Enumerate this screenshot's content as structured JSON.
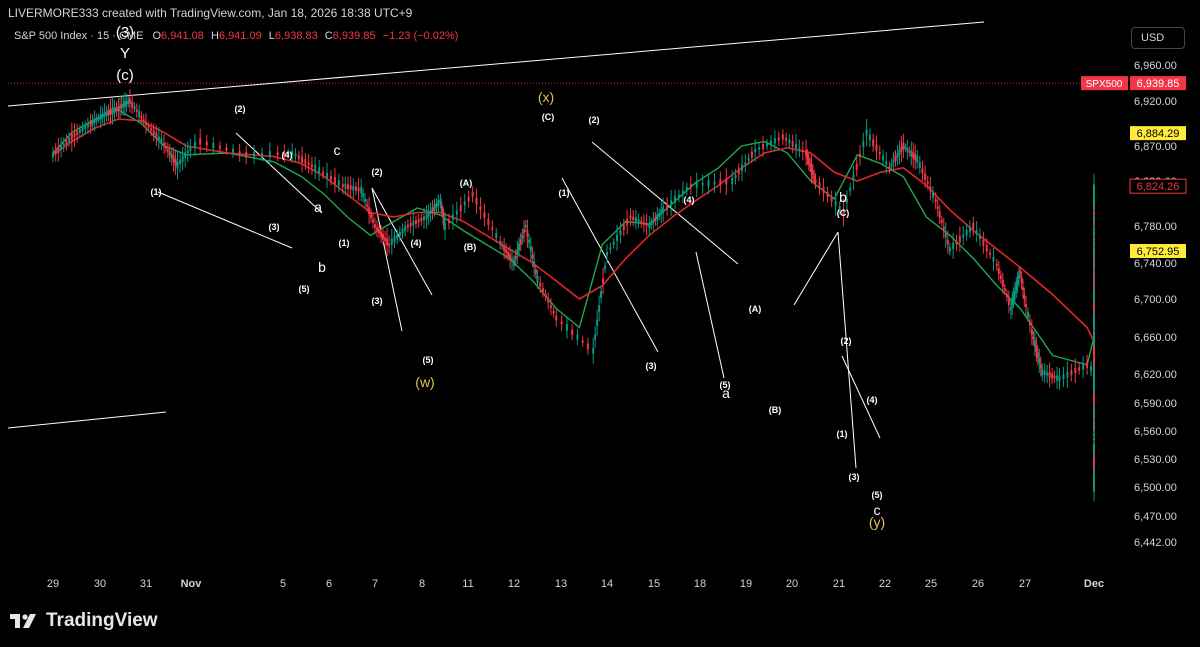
{
  "attribution": "LIVERMORE333 created with TradingView.com, Jan 18, 2026 18:38 UTC+9",
  "legend": {
    "symbol": "S&P 500 Index · 15 · CME",
    "open_label": "O",
    "open": "6,941.08",
    "high_label": "H",
    "high": "6,941.09",
    "low_label": "L",
    "low": "6,938.83",
    "close_label": "C",
    "close": "6,939.85",
    "change": "−1.23 (−0.02%)"
  },
  "currency": "USD",
  "logo_text": "TradingView",
  "colors": {
    "background": "#000000",
    "down": "#f23645",
    "up": "#089981",
    "ma_slow": "#e0262a",
    "ma_fast": "#22c55e",
    "highlight_label": "#ffeb3b",
    "wave_yellow": "#e0c34f",
    "text": "#d1d4dc"
  },
  "chart_data": {
    "type": "line",
    "title": "",
    "y_ticks": [
      "6,960.00",
      "6,920.00",
      "6,870.00",
      "6,830.00",
      "6,780.00",
      "6,740.00",
      "6,700.00",
      "6,660.00",
      "6,620.00",
      "6,590.00",
      "6,560.00",
      "6,530.00",
      "6,500.00",
      "6,470.00",
      "6,442.00"
    ],
    "x_ticks": [
      "29",
      "30",
      "31",
      "Nov",
      "5",
      "6",
      "7",
      "8",
      "11",
      "12",
      "13",
      "14",
      "15",
      "18",
      "19",
      "20",
      "21",
      "22",
      "25",
      "26",
      "27",
      "Dec"
    ],
    "ylim": [
      6442,
      6960
    ],
    "price_tags": [
      {
        "label": "SPX500",
        "value": "6,939.85",
        "style": "red"
      },
      {
        "label": "",
        "value": "6,884.29",
        "style": "yellow"
      },
      {
        "label": "",
        "value": "6,824.26",
        "style": "outline"
      },
      {
        "label": "",
        "value": "6,752.95",
        "style": "yellow"
      }
    ],
    "series": [
      {
        "kind": "price",
        "x": [
          28.6,
          29,
          29.4,
          29.7,
          30,
          30.25,
          30.6,
          31,
          31.3,
          31.7,
          32.2,
          32.8,
          33.3,
          33.9,
          34.3,
          34.6,
          34.9,
          35.3,
          35.7,
          36,
          36.1,
          36.7,
          37.3,
          37.6,
          37.85,
          38.1,
          38.5,
          39.3,
          39.6,
          40.1,
          40.5,
          40.8,
          41.4,
          42.3,
          42.8,
          43.4,
          43.9,
          44.1,
          44.7,
          45.2,
          45.7,
          46,
          46.3,
          46.7,
          47,
          47.5,
          48,
          48.3,
          48.5,
          48.7,
          48.85,
          49.1,
          49.5,
          49.9,
          50.2,
          50.6,
          51,
          51.3,
          51.4,
          51.8,
          52.2,
          52.6,
          52.8,
          53.3,
          53.6,
          53.7,
          54.1,
          54.4,
          54.7,
          55.2,
          55.6,
          56,
          56.6,
          57.2,
          57.8,
          58,
          58.4,
          58.7
        ],
        "y": [
          6860,
          6880,
          6895,
          6905,
          6912,
          6920,
          6895,
          6872,
          6848,
          6875,
          6860,
          6862,
          6845,
          6825,
          6820,
          6780,
          6760,
          6780,
          6790,
          6808,
          6780,
          6815,
          6762,
          6740,
          6780,
          6722,
          6680,
          6645,
          6750,
          6790,
          6780,
          6798,
          6825,
          6830,
          6865,
          6880,
          6862,
          6830,
          6795,
          6885,
          6845,
          6870,
          6855,
          6808,
          6755,
          6780,
          6738,
          6690,
          6730,
          6665,
          6622,
          6615,
          6630,
          6600,
          6645,
          6700,
          6720,
          6672,
          6702,
          6725,
          6682,
          6640,
          6615,
          6600,
          6640,
          6720,
          6648,
          6612,
          6527,
          6540,
          6498,
          6530,
          6620,
          6690,
          6722,
          6760,
          6800,
          6826
        ]
      },
      {
        "kind": "ma_slow",
        "x": [
          28.6,
          29,
          29.5,
          30,
          30.5,
          31,
          31.5,
          32,
          32.5,
          33,
          33.5,
          34,
          34.5,
          35,
          35.5,
          36,
          36.5,
          37,
          37.5,
          38,
          38.5,
          39,
          39.5,
          40,
          40.5,
          41,
          41.5,
          42,
          42.5,
          43,
          43.5,
          44,
          44.5,
          45,
          45.5,
          46,
          46.5,
          47,
          47.5,
          48,
          48.5,
          49,
          49.5,
          50,
          50.5,
          51,
          51.5,
          52,
          52.5,
          53,
          53.5,
          54,
          54.5,
          55,
          55.5,
          56,
          56.5,
          57,
          57.5,
          58,
          58.5,
          58.7
        ],
        "y": [
          6860,
          6875,
          6890,
          6900,
          6898,
          6885,
          6870,
          6862,
          6858,
          6850,
          6835,
          6815,
          6795,
          6790,
          6795,
          6795,
          6785,
          6770,
          6755,
          6740,
          6720,
          6700,
          6715,
          6745,
          6770,
          6790,
          6808,
          6825,
          6845,
          6862,
          6868,
          6862,
          6840,
          6830,
          6840,
          6845,
          6825,
          6798,
          6775,
          6755,
          6735,
          6705,
          6670,
          6655,
          6660,
          6680,
          6690,
          6680,
          6662,
          6648,
          6650,
          6660,
          6640,
          6600,
          6560,
          6560,
          6600,
          6650,
          6690,
          6735,
          6790,
          6815
        ]
      },
      {
        "kind": "ma_fast",
        "x": [
          28.6,
          29,
          29.5,
          30,
          30.5,
          31,
          31.5,
          32,
          32.5,
          33,
          33.5,
          34,
          34.5,
          35,
          35.5,
          36,
          36.5,
          37,
          37.5,
          38,
          38.5,
          39,
          39.5,
          40,
          40.5,
          41,
          41.5,
          42,
          42.5,
          43,
          43.5,
          44,
          44.5,
          45,
          45.5,
          46,
          46.5,
          47,
          47.5,
          48,
          48.5,
          49,
          49.5,
          50,
          50.5,
          51,
          51.5,
          52,
          52.5,
          53,
          53.5,
          54,
          54.5,
          55,
          55.5,
          56,
          56.5,
          57,
          57.5,
          58,
          58.5,
          58.7
        ],
        "y": [
          6862,
          6885,
          6900,
          6910,
          6895,
          6870,
          6860,
          6862,
          6852,
          6835,
          6815,
          6790,
          6770,
          6785,
          6800,
          6792,
          6775,
          6760,
          6745,
          6720,
          6690,
          6670,
          6760,
          6785,
          6782,
          6805,
          6828,
          6845,
          6870,
          6875,
          6862,
          6830,
          6810,
          6860,
          6850,
          6835,
          6790,
          6770,
          6745,
          6715,
          6690,
          6640,
          6630,
          6660,
          6700,
          6710,
          6690,
          6665,
          6630,
          6615,
          6660,
          6680,
          6600,
          6530,
          6520,
          6570,
          6640,
          6700,
          6740,
          6790,
          6815,
          6824
        ]
      }
    ],
    "wave_labels": [
      {
        "text": "(3)",
        "color": "white",
        "size": "lg"
      },
      {
        "text": "Y",
        "color": "white",
        "size": "lg"
      },
      {
        "text": "(c)",
        "color": "white",
        "size": "lg"
      },
      {
        "text": "(1)",
        "color": "white",
        "size": "sm"
      },
      {
        "text": "(2)",
        "color": "white",
        "size": "sm"
      },
      {
        "text": "(4)",
        "color": "white",
        "size": "sm"
      },
      {
        "text": "(3)",
        "color": "white",
        "size": "sm"
      },
      {
        "text": "(5)",
        "color": "white",
        "size": "sm"
      },
      {
        "text": "a",
        "color": "white",
        "size": "md"
      },
      {
        "text": "b",
        "color": "white",
        "size": "md"
      },
      {
        "text": "c",
        "color": "white",
        "size": "md"
      },
      {
        "text": "(1)",
        "color": "white",
        "size": "sm"
      },
      {
        "text": "(2)",
        "color": "white",
        "size": "sm"
      },
      {
        "text": "(3)",
        "color": "white",
        "size": "sm"
      },
      {
        "text": "(4)",
        "color": "white",
        "size": "sm"
      },
      {
        "text": "(5)",
        "color": "white",
        "size": "sm"
      },
      {
        "text": "(w)",
        "color": "yellow",
        "size": "md"
      },
      {
        "text": "(A)",
        "color": "white",
        "size": "sm"
      },
      {
        "text": "(B)",
        "color": "white",
        "size": "sm"
      },
      {
        "text": "(x)",
        "color": "yellow",
        "size": "md"
      },
      {
        "text": "(C)",
        "color": "white",
        "size": "sm"
      },
      {
        "text": "(1)",
        "color": "white",
        "size": "sm"
      },
      {
        "text": "(2)",
        "color": "white",
        "size": "sm"
      },
      {
        "text": "(3)",
        "color": "white",
        "size": "sm"
      },
      {
        "text": "(4)",
        "color": "white",
        "size": "sm"
      },
      {
        "text": "(5)",
        "color": "white",
        "size": "sm"
      },
      {
        "text": "a",
        "color": "white",
        "size": "md"
      },
      {
        "text": "(A)",
        "color": "white",
        "size": "sm"
      },
      {
        "text": "(B)",
        "color": "white",
        "size": "sm"
      },
      {
        "text": "b",
        "color": "white",
        "size": "md"
      },
      {
        "text": "(C)",
        "color": "white",
        "size": "sm"
      },
      {
        "text": "(2)",
        "color": "white",
        "size": "sm"
      },
      {
        "text": "(1)",
        "color": "white",
        "size": "sm"
      },
      {
        "text": "(4)",
        "color": "white",
        "size": "sm"
      },
      {
        "text": "(3)",
        "color": "white",
        "size": "sm"
      },
      {
        "text": "(5)",
        "color": "white",
        "size": "sm"
      },
      {
        "text": "c",
        "color": "white",
        "size": "md"
      },
      {
        "text": "(y)",
        "color": "yellow",
        "size": "md"
      }
    ]
  }
}
